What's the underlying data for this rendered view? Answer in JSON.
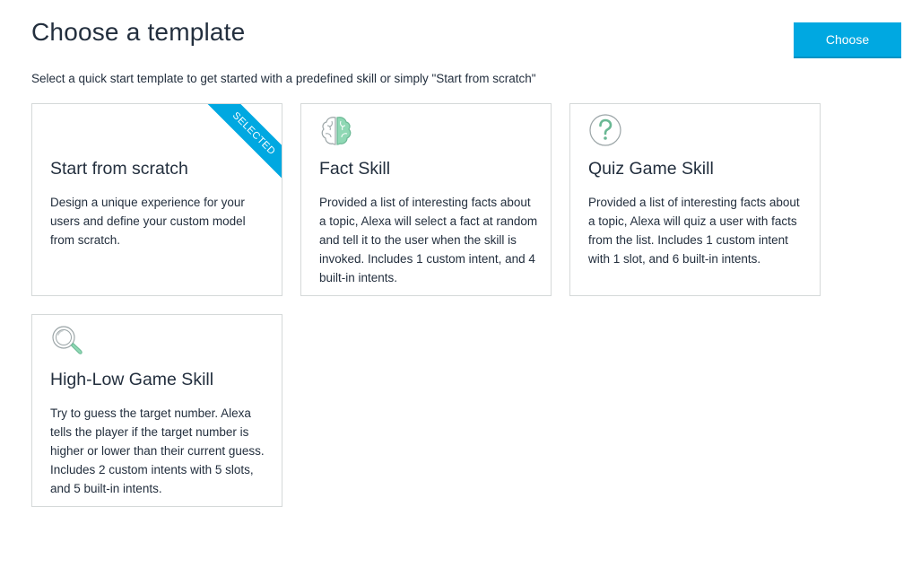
{
  "header": {
    "title": "Choose a template",
    "choose_label": "Choose",
    "subtitle": "Select a quick start template to get started with a predefined skill or simply \"Start from scratch\""
  },
  "colors": {
    "accent": "#00a8e1",
    "text": "#232f3e",
    "border": "#d5d9d9",
    "icon_green": "#8fd8b4"
  },
  "templates": [
    {
      "title": "Start from scratch",
      "description": "Design a unique experience for your users and define your custom model from scratch.",
      "selected": true,
      "badge": "SELECTED",
      "icon": ""
    },
    {
      "title": "Fact Skill",
      "description": "Provided a list of interesting facts about a topic, Alexa will select a fact at random and tell it to the user when the skill is invoked. Includes 1 custom intent, and 4 built-in intents.",
      "selected": false,
      "icon": "brain-icon"
    },
    {
      "title": "Quiz Game Skill",
      "description": "Provided a list of interesting facts about a topic, Alexa will quiz a user with facts from the list. Includes 1 custom intent with 1 slot, and 6 built-in intents.",
      "selected": false,
      "icon": "question-mark-icon"
    },
    {
      "title": "High-Low Game Skill",
      "description": "Try to guess the target number. Alexa tells the player if the target number is higher or lower than their current guess. Includes 2 custom intents with 5 slots, and 5 built-in intents.",
      "selected": false,
      "icon": "magnifier-icon"
    }
  ]
}
